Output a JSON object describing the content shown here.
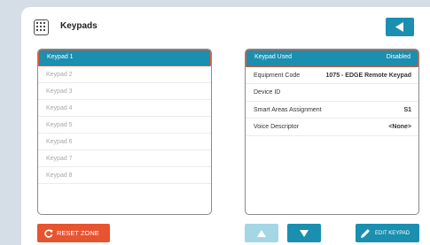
{
  "header": {
    "title": "Keypads",
    "icon": "keypad-icon",
    "back_icon": "back-arrow-icon"
  },
  "keypad_list": {
    "items": [
      "Keypad 1",
      "Keypad 2",
      "Keypad 3",
      "Keypad 4",
      "Keypad 5",
      "Keypad 6",
      "Keypad 7",
      "Keypad 8"
    ],
    "selected_index": 0
  },
  "details": [
    {
      "label": "Keypad Used",
      "value": "Disabled"
    },
    {
      "label": "Equipment Code",
      "value": "1075 - EDGE Remote Keypad"
    },
    {
      "label": "Device ID",
      "value": ""
    },
    {
      "label": "Smart Areas Assignment",
      "value": "S1"
    },
    {
      "label": "Voice Descriptor",
      "value": "<None>"
    }
  ],
  "buttons": {
    "reset_label": "RESET ZONE",
    "edit_label": "EDIT KEYPAD"
  },
  "colors": {
    "accent": "#1a8fb0",
    "highlight": "#e8542f",
    "background": "#d5dde6"
  }
}
